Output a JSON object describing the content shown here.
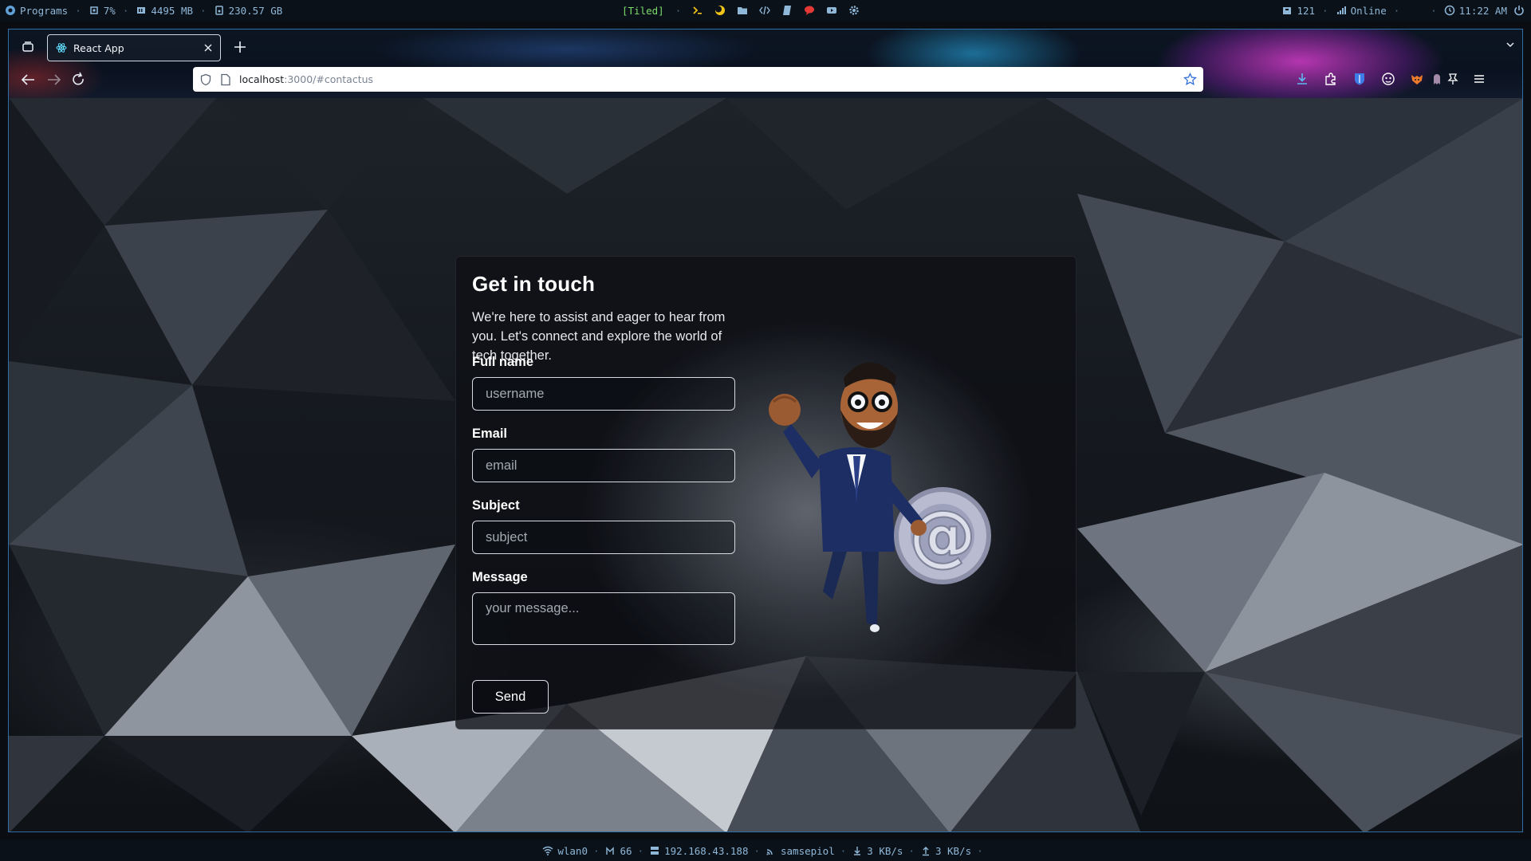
{
  "topbar": {
    "programs": "Programs",
    "cpu": "7%",
    "memory": "4495 MB",
    "disk": "230.57 GB",
    "layout": "[Tiled]",
    "updates": "121",
    "network": "Online",
    "time": "11:22 AM",
    "launchers": [
      "terminal-icon",
      "moon-icon",
      "folder-icon",
      "code-icon",
      "notes-icon",
      "chat-icon",
      "youtube-icon",
      "settings-icon"
    ]
  },
  "browser": {
    "tab_title": "React App",
    "url_host": "localhost",
    "url_path": ":3000/#contactus"
  },
  "contact": {
    "title": "Get in touch",
    "intro": "We're here to assist and eager to hear from you. Let's connect and explore the world of tech together.",
    "full_name_label": "Full name",
    "full_name_placeholder": "username",
    "email_label": "Email",
    "email_placeholder": "email",
    "subject_label": "Subject",
    "subject_placeholder": "subject",
    "message_label": "Message",
    "message_placeholder": "your message...",
    "send_label": "Send"
  },
  "statusbar": {
    "interface": "wlan0",
    "signal": "66",
    "ip": "192.168.43.188",
    "ssid": "samsepiol",
    "download": "3 KB/s",
    "upload": "3 KB/s"
  },
  "colors": {
    "bar_background": "#0b1119",
    "bar_text": "#8fb8d8",
    "window_border": "#2f6fa8",
    "tiled_indicator": "#7bdc6a"
  }
}
